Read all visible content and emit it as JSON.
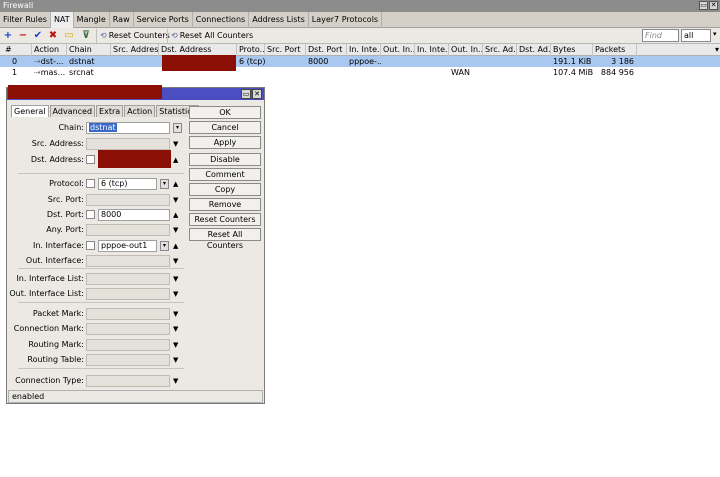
{
  "window": {
    "title": "Firewall"
  },
  "tabs": [
    "Filter Rules",
    "NAT",
    "Mangle",
    "Raw",
    "Service Ports",
    "Connections",
    "Address Lists",
    "Layer7 Protocols"
  ],
  "active_tab": "NAT",
  "toolbar": {
    "reset_counters": "Reset Counters",
    "reset_all_counters": "Reset All Counters",
    "find_placeholder": "Find",
    "filter_value": "all"
  },
  "table": {
    "headers": [
      "#",
      "Action",
      "Chain",
      "Src. Address",
      "Dst. Address",
      "Proto...",
      "Src. Port",
      "Dst. Port",
      "In. Inte...",
      "Out. In...",
      "In. Inte...",
      "Out. In...",
      "Src. Ad...",
      "Dst. Ad...",
      "Bytes",
      "Packets"
    ],
    "rows": [
      {
        "num": "0",
        "action": "dst-...",
        "chain": "dstnat",
        "protocol": "6 (tcp)",
        "dst_port": "8000",
        "in_iface": "pppoe-...",
        "out_iface_list": "",
        "bytes": "191.1 KiB",
        "packets": "3 186"
      },
      {
        "num": "1",
        "action": "mas...",
        "chain": "srcnat",
        "protocol": "",
        "dst_port": "",
        "in_iface": "",
        "out_iface_list": "WAN",
        "bytes": "107.4 MiB",
        "packets": "884 956"
      }
    ]
  },
  "dialog": {
    "tabs": [
      "General",
      "Advanced",
      "Extra",
      "Action",
      "Statistics"
    ],
    "active_tab": "General",
    "labels": {
      "chain": "Chain:",
      "src_address": "Src. Address:",
      "dst_address": "Dst. Address:",
      "protocol": "Protocol:",
      "src_port": "Src. Port:",
      "dst_port": "Dst. Port:",
      "any_port": "Any. Port:",
      "in_interface": "In. Interface:",
      "out_interface": "Out. Interface:",
      "in_interface_list": "In. Interface List:",
      "out_interface_list": "Out. Interface List:",
      "packet_mark": "Packet Mark:",
      "connection_mark": "Connection Mark:",
      "routing_mark": "Routing Mark:",
      "routing_table": "Routing Table:",
      "connection_type": "Connection Type:"
    },
    "values": {
      "chain": "dstnat",
      "protocol": "6 (tcp)",
      "dst_port": "8000",
      "in_interface": "pppoe-out1"
    },
    "buttons": [
      "OK",
      "Cancel",
      "Apply",
      "Disable",
      "Comment",
      "Copy",
      "Remove",
      "Reset Counters",
      "Reset All Counters"
    ],
    "status": "enabled"
  }
}
